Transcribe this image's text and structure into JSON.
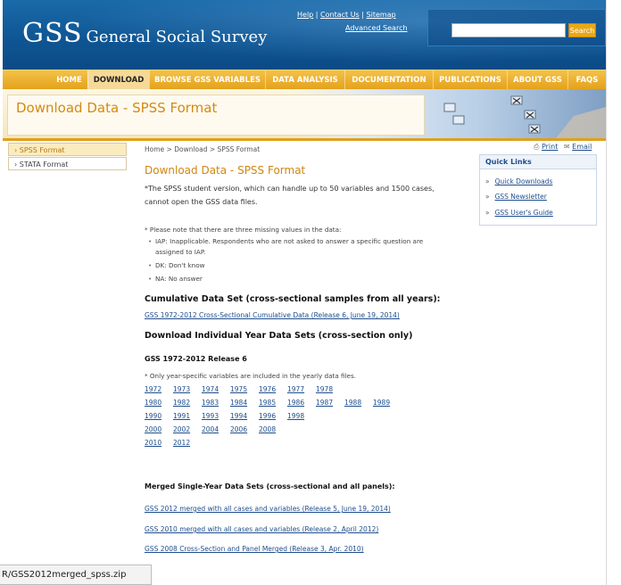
{
  "header": {
    "logo_big": "GSS",
    "logo_small": "General Social Survey",
    "top_links": [
      "Help",
      "Contact Us",
      "Sitemap"
    ],
    "advanced_search": "Advanced Search",
    "search_button": "Search",
    "search_value": ""
  },
  "nav": {
    "items": [
      "HOME",
      "DOWNLOAD",
      "BROWSE GSS VARIABLES",
      "DATA ANALYSIS",
      "DOCUMENTATION",
      "PUBLICATIONS",
      "ABOUT GSS",
      "FAQS"
    ],
    "active": "DOWNLOAD"
  },
  "banner": {
    "title": "Download Data - SPSS Format"
  },
  "left_menu": {
    "items": [
      "SPSS Format",
      "STATA Format"
    ],
    "active": "SPSS Format"
  },
  "breadcrumb": "Home > Download > SPSS Format",
  "tools": {
    "print": "Print",
    "email": "Email"
  },
  "main": {
    "title": "Download Data - SPSS Format",
    "intro_line1": "*The SPSS student version, which  can handle up to 50 variables and 1500 cases,",
    "intro_line2": "cannot open the GSS data files.",
    "missing_note": "* Please note that there are three missing values in the data:",
    "missing_values": [
      "IAP: Inapplicable. Respondents who are not asked to answer a specific question are",
      "assigned to IAP.",
      "DK: Don't know",
      "NA: No answer"
    ],
    "cumulative_heading": "Cumulative Data Set (cross-sectional samples from all years):",
    "cumulative_link": "GSS 1972-2012 Cross-Sectional Cumulative Data (Release 6, June 19, 2014)",
    "individual_heading": "Download Individual Year Data Sets (cross-section only)",
    "release_heading": "GSS 1972-2012 Release 6",
    "year_note": "* Only year-specific variables are included in the yearly data files.",
    "years": [
      [
        "1972",
        "1973",
        "1974",
        "1975",
        "1976",
        "1977",
        "1978"
      ],
      [
        "1980",
        "1982",
        "1983",
        "1984",
        "1985",
        "1986",
        "1987",
        "1988",
        "1989"
      ],
      [
        "1990",
        "1991",
        "1993",
        "1994",
        "1996",
        "1998"
      ],
      [
        "2000",
        "2002",
        "2004",
        "2006",
        "2008"
      ],
      [
        "2010",
        "2012"
      ]
    ],
    "merged_heading": "Merged Single-Year Data Sets (cross-sectional and all panels):",
    "merged_links": [
      "GSS 2012 merged with all cases and variables (Release 5, June 19, 2014)",
      "GSS 2010 merged with all cases and variables (Release 2, April 2012)",
      "GSS 2008 Cross-Section and Panel Merged (Release 3, Apr. 2010)"
    ]
  },
  "quick_links": {
    "title": "Quick Links",
    "items": [
      "Quick Downloads",
      "GSS Newsletter",
      "GSS User's Guide"
    ]
  },
  "status_bar": "R/GSS2012merged_spss.zip",
  "colors": {
    "header_blue": "#0f5694",
    "nav_gold": "#e4a21c",
    "title_orange": "#cf8612",
    "link_blue": "#1f4e8c"
  }
}
